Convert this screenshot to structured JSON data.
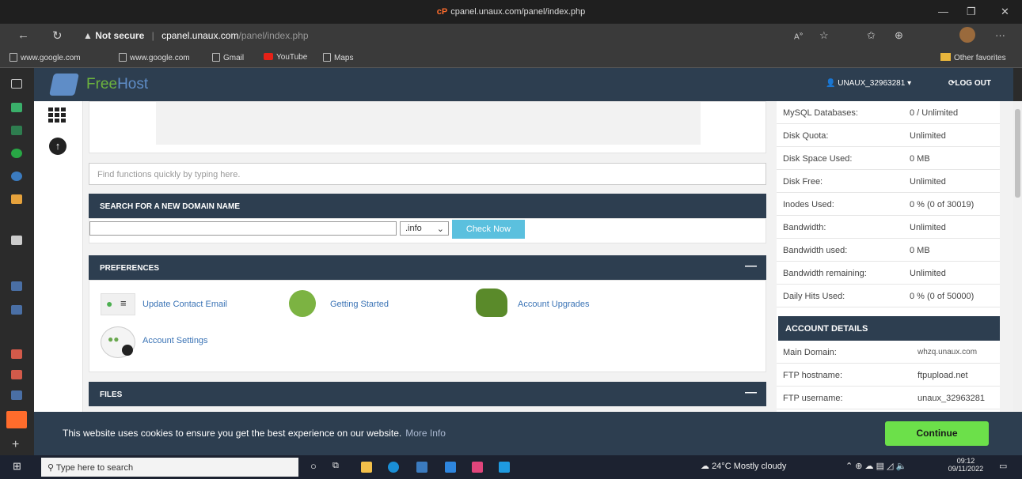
{
  "browser": {
    "window_title": "cpanel.unaux.com/panel/index.php",
    "warning": "Not secure",
    "url_domain": "cpanel.unaux.com",
    "url_path": "/panel/index.php"
  },
  "bookmarks": [
    "www.google.com",
    "www.google.com",
    "Gmail",
    "YouTube",
    "Maps"
  ],
  "other_favorites": "Other favorites",
  "app": {
    "brand_free": "Free",
    "brand_host": "Host",
    "username": "UNAUX_32963281",
    "logout": "LOG OUT"
  },
  "find_placeholder": "Find functions quickly by typing here.",
  "domain_search": {
    "header": "SEARCH FOR A NEW DOMAIN NAME",
    "tld": ".info",
    "button": "Check Now"
  },
  "preferences": {
    "header": "PREFERENCES",
    "items": [
      "Update Contact Email",
      "Getting Started",
      "Account Upgrades",
      "Account Settings"
    ]
  },
  "files_header": "FILES",
  "stats": [
    {
      "k": "MySQL Databases:",
      "v": "0 / Unlimited"
    },
    {
      "k": "Disk Quota:",
      "v": "Unlimited"
    },
    {
      "k": "Disk Space Used:",
      "v": "0 MB"
    },
    {
      "k": "Disk Free:",
      "v": "Unlimited"
    },
    {
      "k": "Inodes Used:",
      "v": "0 % (0 of 30019)"
    },
    {
      "k": "Bandwidth:",
      "v": "Unlimited"
    },
    {
      "k": "Bandwidth used:",
      "v": "0 MB"
    },
    {
      "k": "Bandwidth remaining:",
      "v": "Unlimited"
    },
    {
      "k": "Daily Hits Used:",
      "v": "0 % (0 of 50000)"
    }
  ],
  "account_details": {
    "header": "ACCOUNT DETAILS",
    "rows": [
      {
        "k": "Main Domain:",
        "v": "whzq.unaux.com"
      },
      {
        "k": "FTP hostname:",
        "v": "ftpupload.net"
      },
      {
        "k": "FTP username:",
        "v": "unaux_32963281"
      }
    ]
  },
  "cookie": {
    "message": "This website uses cookies to ensure you get the best experience on our website.",
    "more": "More Info",
    "button": "Continue"
  },
  "taskbar": {
    "search_placeholder": "Type here to search",
    "weather": "24°C  Mostly cloudy",
    "time": "09:12",
    "date": "09/11/2022"
  }
}
